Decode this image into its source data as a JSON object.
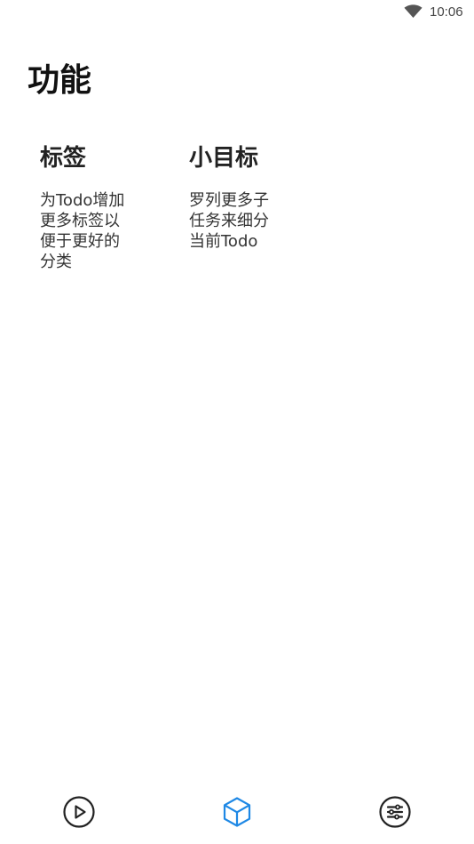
{
  "status_bar": {
    "time": "10:06",
    "wifi_icon": "wifi-icon"
  },
  "page": {
    "title": "功能"
  },
  "features": [
    {
      "title": "标签",
      "description": "为Todo增加更多标签以便于更好的分类"
    },
    {
      "title": "小目标",
      "description": "罗列更多子任务来细分当前Todo"
    }
  ],
  "bottom_nav": {
    "items": [
      {
        "icon": "play-circle-icon",
        "active": false
      },
      {
        "icon": "cube-icon",
        "active": true
      },
      {
        "icon": "settings-list-icon",
        "active": false
      }
    ],
    "active_color": "#1e88e5",
    "inactive_color": "#222222"
  }
}
